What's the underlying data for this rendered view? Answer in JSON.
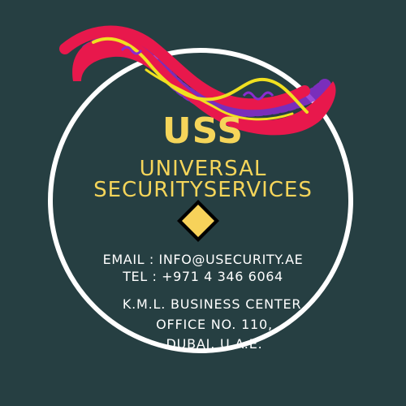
{
  "colors": {
    "background": "#263f42",
    "accent_text": "#f5d55a",
    "ring": "#ffffff",
    "ribbon_main": "#e8184c",
    "ribbon_thread": "#f0e020",
    "ribbon_accent": "#8a2bd0",
    "diamond_fill": "#f7d25a",
    "diamond_outline": "#000000"
  },
  "logo": {
    "abbreviation": "USS",
    "name_line_1": "UNIVERSAL",
    "name_line_2": "SECURITYSERVICES"
  },
  "contact": {
    "email": "EMAIL : INFO@USECURITY.AE",
    "tel": "TEL : +971 4 346 6064"
  },
  "address": {
    "line_1": "K.M.L. BUSINESS CENTER,",
    "line_2": "OFFICE NO. 110,",
    "line_3": "DUBAI, U.A.E."
  },
  "icons": {
    "ribbon": "ribbon-swirl-icon",
    "diamond": "diamond-icon"
  }
}
